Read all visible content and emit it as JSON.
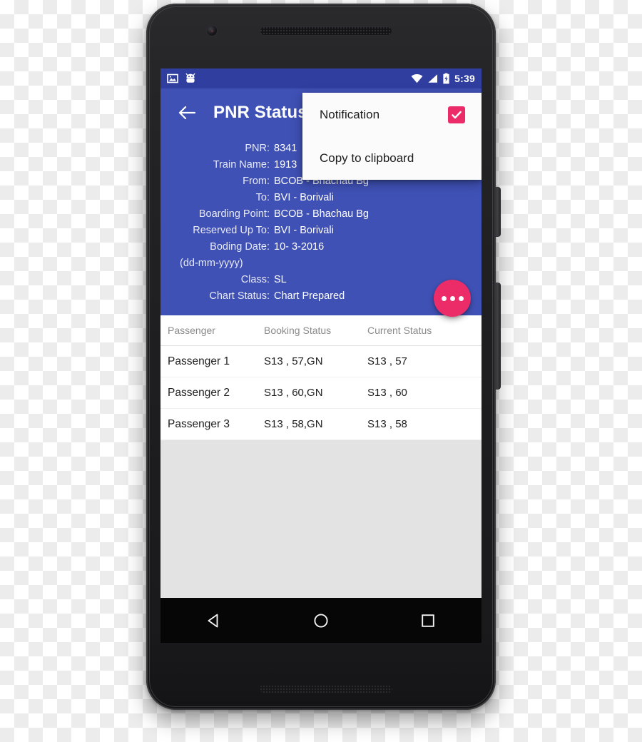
{
  "device": {
    "name": "android-phone",
    "side_buttons": [
      "power-button",
      "volume-rocker"
    ]
  },
  "colors": {
    "primary": "#3f51b5",
    "primary_dark": "#303f9f",
    "accent": "#ec2c69",
    "screen_bg": "#ffffff",
    "filler_bg": "#e3e3e3",
    "nav_bg": "#060606"
  },
  "statusbar": {
    "time": "5:39",
    "left_icons": [
      "screenshot-icon",
      "android-bugdroid-icon"
    ],
    "right_icons": [
      "wifi-icon",
      "cellular-signal-icon",
      "battery-charging-icon"
    ]
  },
  "appbar": {
    "back_icon": "back-arrow-icon",
    "title": "PNR Status"
  },
  "menu": {
    "items": [
      {
        "label": "Notification",
        "checked": true,
        "checkbox_icon": "checkbox-checked-icon"
      },
      {
        "label": "Copy to clipboard",
        "checked": false
      }
    ]
  },
  "fab": {
    "icon": "more-horizontal-icon",
    "label": "more-options"
  },
  "info": {
    "rows": [
      {
        "label": "PNR:",
        "value": "8341"
      },
      {
        "label": "Train Name:",
        "value": "1913"
      },
      {
        "label": "From:",
        "value": "BCOB - Bhachau Bg"
      },
      {
        "label": "To:",
        "value": "BVI - Borivali"
      },
      {
        "label": "Boarding Point:",
        "value": "BCOB - Bhachau Bg"
      },
      {
        "label": "Reserved Up To:",
        "value": "BVI - Borivali"
      },
      {
        "label": "Boding Date:",
        "value": "10- 3-2016"
      }
    ],
    "date_format_note": "(dd-mm-yyyy)",
    "rows_after_note": [
      {
        "label": "Class:",
        "value": "SL"
      },
      {
        "label": "Chart Status:",
        "value": "Chart Prepared"
      }
    ]
  },
  "table": {
    "headers": [
      "Passenger",
      "Booking Status",
      "Current Status"
    ],
    "rows": [
      {
        "passenger": "Passenger 1",
        "booking_status": "S13 , 57,GN",
        "current_status": "S13 , 57"
      },
      {
        "passenger": "Passenger 2",
        "booking_status": "S13 , 60,GN",
        "current_status": "S13 , 60"
      },
      {
        "passenger": "Passenger 3",
        "booking_status": "S13 , 58,GN",
        "current_status": "S13 , 58"
      }
    ]
  },
  "navbar": {
    "buttons": [
      {
        "name": "back",
        "icon": "triangle-back-icon"
      },
      {
        "name": "home",
        "icon": "circle-home-icon"
      },
      {
        "name": "recents",
        "icon": "square-recents-icon"
      }
    ]
  }
}
